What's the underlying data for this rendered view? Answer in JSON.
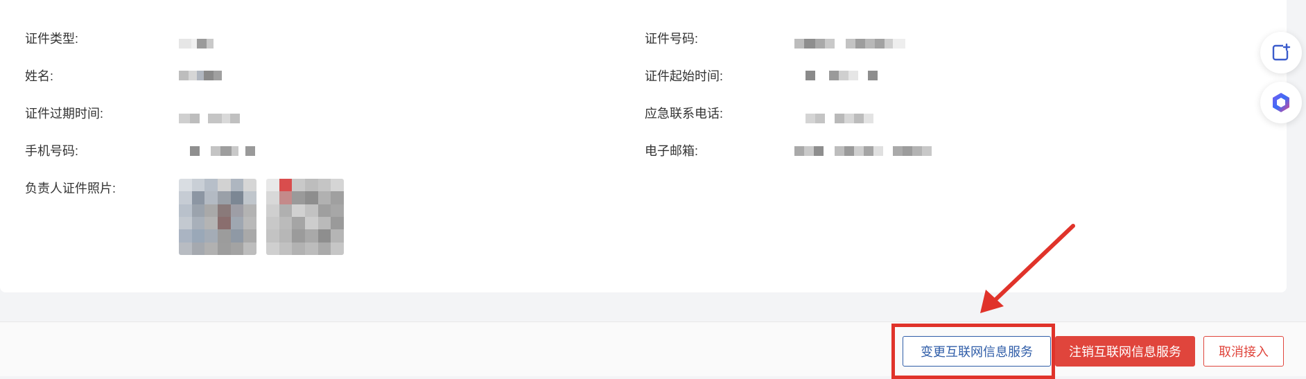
{
  "fields": {
    "id_type_label": "证件类型:",
    "name_label": "姓名:",
    "expiry_label": "证件过期时间:",
    "phone_label": "手机号码:",
    "photo_label": "负责人证件照片:",
    "id_number_label": "证件号码:",
    "start_time_label": "证件起始时间:",
    "emergency_phone_label": "应急联系电话:",
    "email_label": "电子邮箱:"
  },
  "side_icons": [
    "add-note-icon",
    "hexagon-logo-icon"
  ],
  "actions": {
    "change_label": "变更互联网信息服务",
    "cancel_service_label": "注销互联网信息服务",
    "cancel_access_label": "取消接入"
  },
  "colors": {
    "primary": "#2f5da8",
    "danger": "#e0453c",
    "annotation": "#e0332a"
  }
}
